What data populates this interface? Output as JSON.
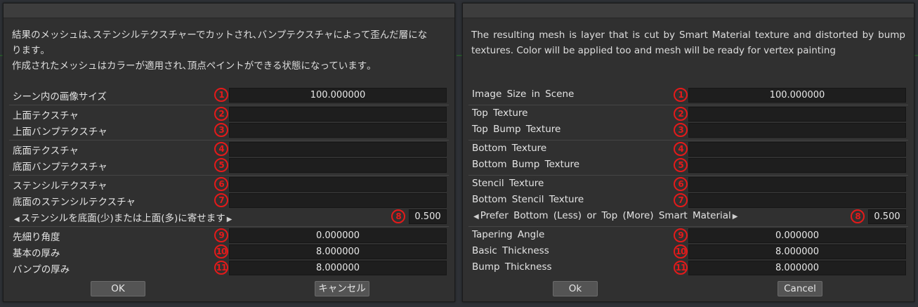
{
  "dialogs": {
    "jp": {
      "description": "結果のメッシュは､ステンシルテクスチャーでカットされ､バンプテクスチャによって歪んだ層にな\nります｡\n作成されたメッシュはカラーが適用され､頂点ペイントができる状態になっています｡",
      "fields": [
        {
          "num": "1",
          "label": "シーン内の画像サイズ",
          "value": "100.000000"
        },
        {
          "num": "2",
          "label": "上面テクスチャ",
          "value": ""
        },
        {
          "num": "3",
          "label": "上面バンプテクスチャ",
          "value": ""
        },
        {
          "num": "4",
          "label": "底面テクスチャ",
          "value": ""
        },
        {
          "num": "5",
          "label": "底面バンプテクスチャ",
          "value": ""
        },
        {
          "num": "6",
          "label": "ステンシルテクスチャ",
          "value": ""
        },
        {
          "num": "7",
          "label": "底面のステンシルテクスチャ",
          "value": ""
        },
        {
          "num": "8",
          "label": "ステンシルを底面(少)または上面(多)に寄せます",
          "value": "0.500"
        },
        {
          "num": "9",
          "label": "先細り角度",
          "value": "0.000000"
        },
        {
          "num": "10",
          "label": "基本の厚み",
          "value": "8.000000"
        },
        {
          "num": "11",
          "label": "バンプの厚み",
          "value": "8.000000"
        }
      ],
      "ok_label": "OK",
      "cancel_label": "キャンセル"
    },
    "en": {
      "description": "The resulting mesh is layer that is cut by Smart Material texture and distorted by bump textures. Color will be applied too and mesh will be ready for vertex painting",
      "fields": [
        {
          "num": "1",
          "label": "Image Size in Scene",
          "value": "100.000000"
        },
        {
          "num": "2",
          "label": "Top Texture",
          "value": ""
        },
        {
          "num": "3",
          "label": "Top Bump Texture",
          "value": ""
        },
        {
          "num": "4",
          "label": "Bottom Texture",
          "value": ""
        },
        {
          "num": "5",
          "label": "Bottom Bump Texture",
          "value": ""
        },
        {
          "num": "6",
          "label": "Stencil Texture",
          "value": ""
        },
        {
          "num": "7",
          "label": "Bottom Stencil Texture",
          "value": ""
        },
        {
          "num": "8",
          "label": "Prefer Bottom (Less) or Top (More) Smart Material",
          "value": "0.500"
        },
        {
          "num": "9",
          "label": "Tapering Angle",
          "value": "0.000000"
        },
        {
          "num": "10",
          "label": "Basic Thickness",
          "value": "8.000000"
        },
        {
          "num": "11",
          "label": "Bump Thickness",
          "value": "8.000000"
        }
      ],
      "ok_label": "Ok",
      "cancel_label": "Cancel"
    }
  },
  "icons": {
    "slider_left": "triangle-left-icon",
    "slider_right": "triangle-right-icon"
  },
  "colors": {
    "badge": "#e41a1a",
    "dialog_bg": "#303030",
    "field_bg": "#1e1e1e",
    "button_bg": "#545454"
  }
}
